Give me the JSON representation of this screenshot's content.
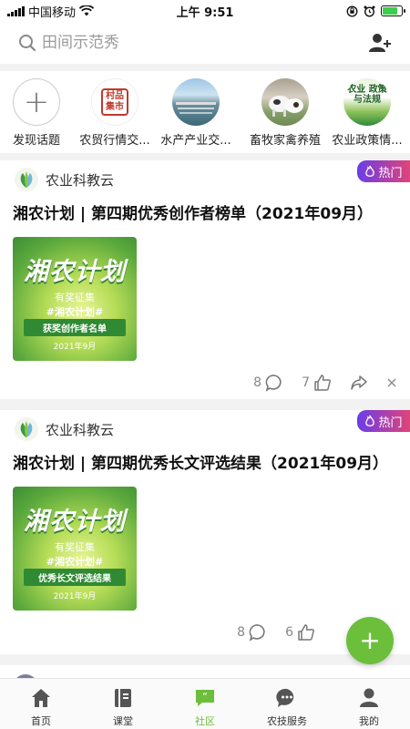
{
  "status_bar": {
    "carrier": "中国移动",
    "time": "上午 9:51"
  },
  "search": {
    "placeholder": "田间示范秀"
  },
  "topics": [
    {
      "label": "发现话题",
      "icon": "plus-icon"
    },
    {
      "label": "农贸行情交...",
      "icon": "market-seal-icon",
      "seal_text": "村品集市"
    },
    {
      "label": "水产产业交...",
      "icon": "aquaculture-photo"
    },
    {
      "label": "畜牧家禽养殖",
      "icon": "livestock-photo"
    },
    {
      "label": "农业政策情...",
      "icon": "policy-icon",
      "badge_text": "农业 政策与法规"
    }
  ],
  "posts": [
    {
      "author": "农业科教云",
      "badge": "热门",
      "title": "湘农计划 | 第四期优秀创作者榜单（2021年09月）",
      "thumb": {
        "main": "湘农计划",
        "sub": "有奖征集",
        "tag": "#湘农计划#",
        "desc": "获奖创作者名单",
        "date": "2021年9月"
      },
      "comments": "8",
      "likes": "7"
    },
    {
      "author": "农业科教云",
      "badge": "热门",
      "title": "湘农计划 | 第四期优秀长文评选结果（2021年09月）",
      "thumb": {
        "main": "湘农计划",
        "sub": "有奖征集",
        "tag": "#湘农计划#",
        "desc": "优秀长文评选结果",
        "date": "2021年9月"
      },
      "comments": "8",
      "likes": "6"
    }
  ],
  "fab": {
    "label": "+"
  },
  "tabs": [
    {
      "label": "首页",
      "icon": "home-icon"
    },
    {
      "label": "课堂",
      "icon": "book-icon"
    },
    {
      "label": "社区",
      "icon": "community-icon",
      "active": true
    },
    {
      "label": "农技服务",
      "icon": "chat-icon"
    },
    {
      "label": "我的",
      "icon": "profile-icon"
    }
  ],
  "colors": {
    "accent": "#6cbf3a",
    "hot_badge_start": "#6a3de8",
    "hot_badge_end": "#e0437a"
  }
}
